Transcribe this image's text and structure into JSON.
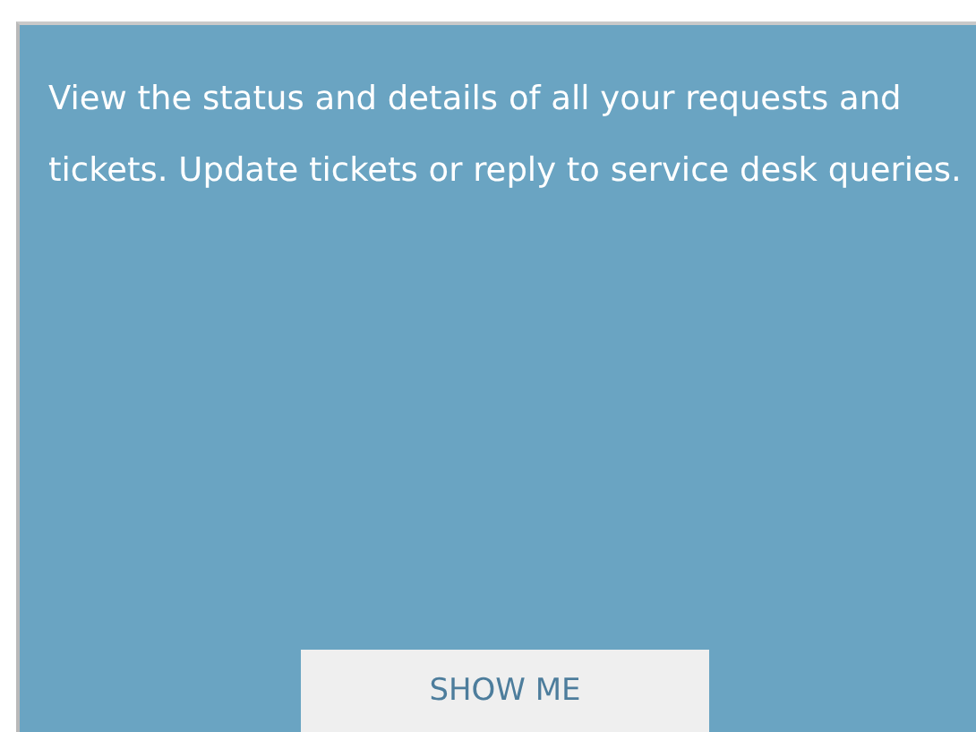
{
  "card": {
    "description": "View the status and details of all your requests and tickets. Update tickets or reply to service desk queries.",
    "button": "SHOW ME"
  }
}
